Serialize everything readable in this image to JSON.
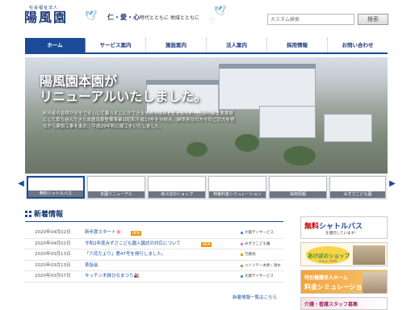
{
  "header": {
    "logo_sub": "社会福祉法人",
    "logo_main": "陽風園",
    "motto": "仁・愛・心",
    "slogan": "時代とともに 地域とともに",
    "search_brand": "Google",
    "search_placeholder": "カスタム検索",
    "search_button": "検索"
  },
  "nav": [
    {
      "label": "ホーム",
      "active": true
    },
    {
      "label": "サービス案内",
      "active": false
    },
    {
      "label": "施設案内",
      "active": false
    },
    {
      "label": "法人案内",
      "active": false
    },
    {
      "label": "採用情報",
      "active": false
    },
    {
      "label": "お問い合わせ",
      "active": false
    }
  ],
  "hero": {
    "title_line1": "陽風園本園が",
    "title_line2": "リニューアルいたしました。",
    "text": "利用者の皆様が安全で安心して暮らすことができる快適な環境を整えるため、当園の最重要課題として取り組んできた本園改築整備事業は昭和平成17年を分岐点、関係各位の方々のご尽力を得ながら建設工事を進め、平成29年秋に竣工をいたしました。"
  },
  "thumbs": [
    {
      "caption": "無料シャトルバス",
      "active": true
    },
    {
      "caption": "本園リニューアル",
      "active": false
    },
    {
      "caption": "あけぼのショップ",
      "active": false
    },
    {
      "caption": "特養料金シミュレーション",
      "active": false
    },
    {
      "caption": "採用情報",
      "active": false
    },
    {
      "caption": "みずさこども園",
      "active": false
    }
  ],
  "news": {
    "title": "新着情報",
    "new_label": "NEW",
    "items": [
      {
        "date": "2020年04月02日",
        "title": "新年度スタート🌸",
        "new": true,
        "cat": "大都デイサービス",
        "cat_color": "#4a90d9"
      },
      {
        "date": "2020年04月02日",
        "title": "令和2年度みずさこども園入園式の対応について",
        "new": true,
        "cat": "みずさこども園",
        "cat_color": "#e07aa0"
      },
      {
        "date": "2020年03月13日",
        "title": "「六花だより」第47号を発行しました。",
        "new": false,
        "cat": "万路地",
        "cat_color": "#e8960c"
      },
      {
        "date": "2020年03月13日",
        "title": "茶話会",
        "new": false,
        "cat": "ハイリテー木原・清水",
        "cat_color": "#7cb342"
      },
      {
        "date": "2020年03月07日",
        "title": "キッチン木鉢ひなまつり🎎",
        "new": false,
        "cat": "大都デイサービス",
        "cat_color": "#4a90d9"
      }
    ],
    "more": "新着情報一覧はこちら"
  },
  "banners": {
    "shuttle_free": "無料",
    "shuttle_main": "シャトルバス",
    "shuttle_sub": "を運行しています！",
    "shop_name": "あけぼのショップ",
    "shop_since": "Since 1990",
    "sim_l1": "特別養護老人ホーム",
    "sim_l2": "料金シミュレーション",
    "recruit": "介護・看護スタッフ募集"
  },
  "colors": {
    "brand": "#1b4a96",
    "link": "#1a4fa0",
    "new_badge": "#e8960c"
  }
}
